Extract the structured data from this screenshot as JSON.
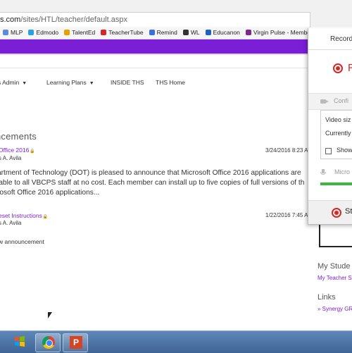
{
  "browser": {
    "url_host": "s.com",
    "url_path": "/sites/HTL/teacher/default.aspx",
    "bookmarks": [
      {
        "label": "MLP",
        "color": "#5b8bd8"
      },
      {
        "label": "Edmodo",
        "color": "#2aa1dc"
      },
      {
        "label": "TalentEd",
        "color": "#e6a100"
      },
      {
        "label": "TeacherTube",
        "color": "#d42828"
      },
      {
        "label": "Remind",
        "color": "#3d6fd8"
      },
      {
        "label": "WL",
        "color": "#333333"
      },
      {
        "label": "Educanon",
        "color": "#1f5fbf"
      },
      {
        "label": "Virgin Pulse - Membe",
        "color": "#7b2a8c"
      }
    ]
  },
  "nav": {
    "items": [
      "s Admin",
      "Learning Plans",
      "INSIDE THS",
      "THS Home"
    ]
  },
  "announcements": {
    "title": "ncements",
    "items": [
      {
        "title": "Office 2016",
        "author": "s A. Avila",
        "date": "3/24/2016 8:23 A"
      },
      {
        "title": "eset Instructions",
        "author": "s A. Avila",
        "date": "1/22/2016 7:45 A"
      }
    ],
    "body_lines": [
      "artment of Technology (DOT) is pleased to announce that Microsoft Office 2016 applications are",
      "lable to all VBCPS staff at no cost. Each member can install up to five copies of full versions of th",
      "rosoft Office 2016 applications..."
    ],
    "add_link": "w announcement"
  },
  "right_column": {
    "my_students": "My Stude",
    "my_teacher": "My Teacher S",
    "links": "Links",
    "synergy": "» Synergy GR"
  },
  "recorder": {
    "header": "Record",
    "record_button": "R",
    "config_label": "Confi",
    "video_size": "Video siz",
    "currently": "Currently",
    "show_label": "Show",
    "mic_label": "Micro",
    "mic_level": 0.75,
    "stop_label": "St",
    "colors": {
      "record": "#d42828",
      "level": "#39b83b"
    }
  },
  "taskbar": {
    "apps": [
      "start",
      "chrome",
      "powerpoint"
    ],
    "ppt_letter": "P"
  },
  "colors": {
    "purple": "#7b1fd6"
  }
}
